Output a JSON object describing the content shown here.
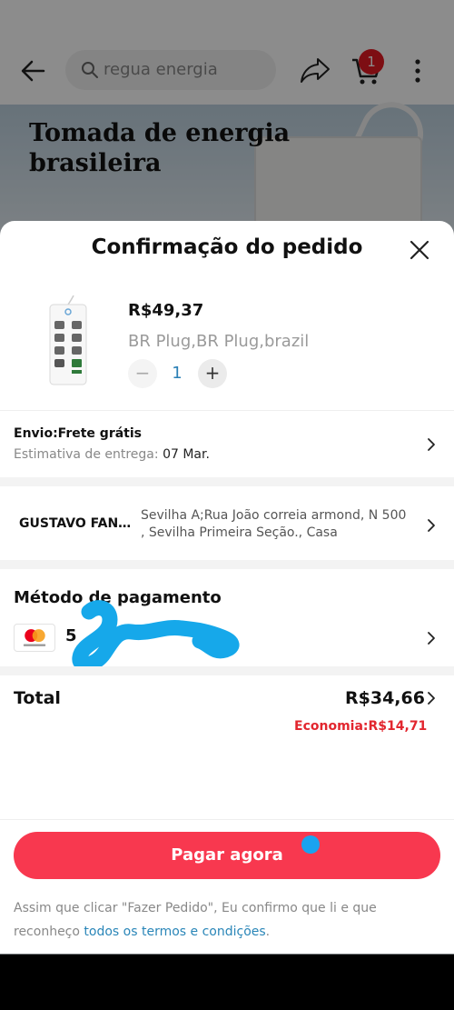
{
  "background": {
    "search_placeholder": "regua energia",
    "cart_badge": "1",
    "banner_title": "Tomada de energia brasileira"
  },
  "sheet": {
    "title": "Confirmação do pedido"
  },
  "product": {
    "price": "R$49,37",
    "variant": "BR Plug,BR Plug,brazil",
    "qty_minus": "−",
    "quantity": "1",
    "qty_plus": "+"
  },
  "shipping": {
    "label": "Envio:Frete grátis",
    "eta_label": "Estimativa de entrega: ",
    "eta_date": "07 Mar."
  },
  "address": {
    "name": "GUSTAVO FANTI...",
    "line": "Sevilha A;Rua João correia armond,  N 500 , Sevilha Primeira Seção., Casa"
  },
  "payment": {
    "title": "Método de pagamento",
    "card_text": "5"
  },
  "total": {
    "label": "Total",
    "value": "R$34,66",
    "savings": "Economia:R$14,71"
  },
  "cta": {
    "pay_label": "Pagar agora"
  },
  "legal": {
    "text": "Assim que clicar \"Fazer Pedido\", Eu confirmo que li e que reconheço ",
    "link": "todos os termos e condições",
    "end": "."
  },
  "colors": {
    "accent": "#f8384f",
    "savings": "#e2262e",
    "link": "#2a86b8",
    "badge": "#e31b23"
  }
}
